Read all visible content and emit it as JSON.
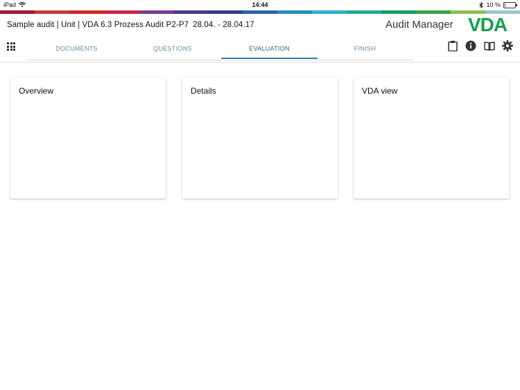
{
  "status_bar": {
    "device": "iPad",
    "time": "14:44",
    "battery": "10 %",
    "battery_level": 0.1
  },
  "color_strip": [
    "#9c1d2a",
    "#c23a3e",
    "#d3282b",
    "#c9244e",
    "#7b3c8c",
    "#4a3b8e",
    "#2f3d8a",
    "#2b62a8",
    "#2a8fb9",
    "#2fb1c7",
    "#27a59b",
    "#1a9b5a",
    "#3aa34a",
    "#8cc04a",
    "#9bc6c7"
  ],
  "header": {
    "audit_title": "Sample audit | Unit | VDA 6.3 Prozess Audit P2-P7",
    "dates": "28.04. - 28.04.17",
    "app_name": "Audit Manager",
    "logo_text": "VDA",
    "logo_color": "#13a14a"
  },
  "tabs": [
    {
      "label": "DOCUMENTS",
      "active": false
    },
    {
      "label": "QUESTIONS",
      "active": false
    },
    {
      "label": "EVALUATION",
      "active": true
    },
    {
      "label": "FINISH",
      "active": false
    }
  ],
  "toolbar": {
    "icons": [
      "apps-icon",
      "clipboard-icon",
      "info-icon",
      "book-icon",
      "gear-icon"
    ]
  },
  "cards": [
    {
      "title": "Overview"
    },
    {
      "title": "Details"
    },
    {
      "title": "VDA view"
    }
  ]
}
